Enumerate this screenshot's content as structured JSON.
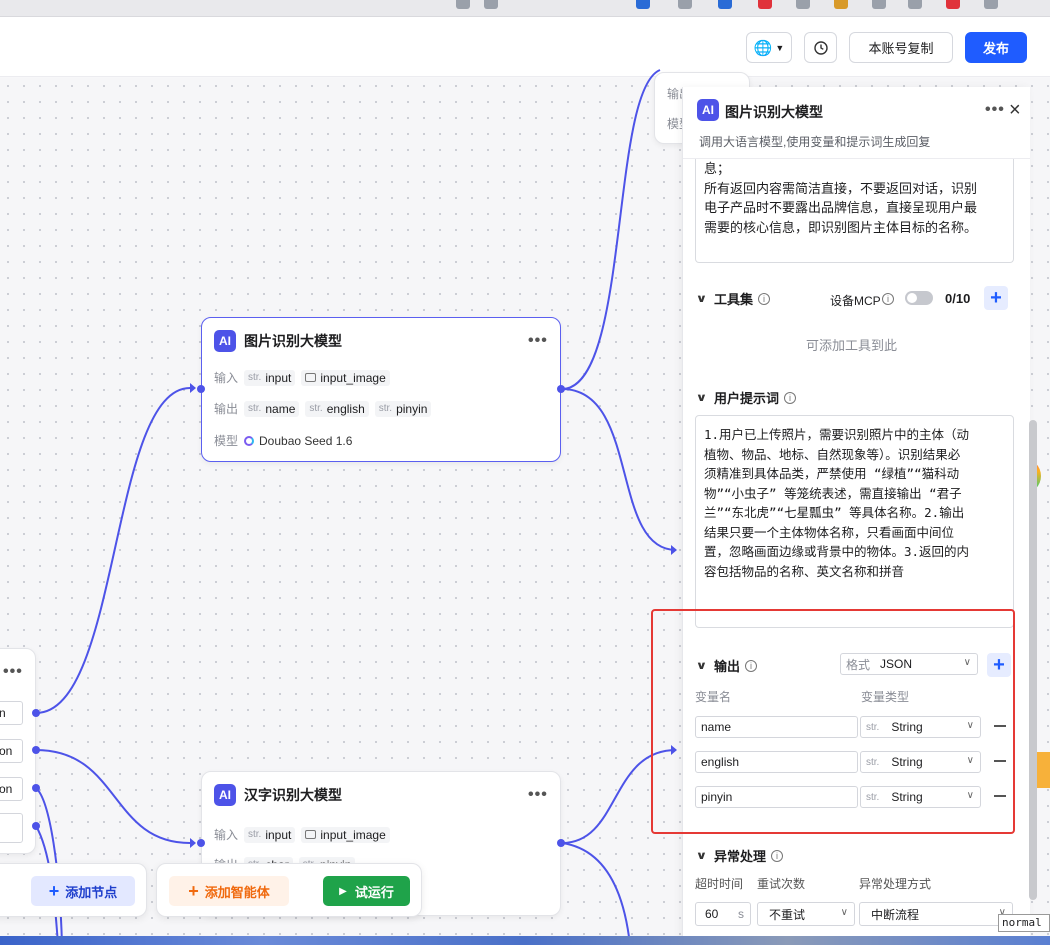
{
  "topbar": {
    "language_icon": "globe-icon",
    "history_icon": "clock-icon",
    "copy_label": "本账号复制",
    "publish_label": "发布"
  },
  "nodes": {
    "image_llm": {
      "title": "图片识别大模型",
      "input_label": "输入",
      "inputs": [
        {
          "type": "str.",
          "name": "input"
        },
        {
          "type": "img",
          "name": "input_image"
        }
      ],
      "output_label": "输出",
      "outputs": [
        {
          "type": "str.",
          "name": "name"
        },
        {
          "type": "str.",
          "name": "english"
        },
        {
          "type": "str.",
          "name": "pinyin"
        }
      ],
      "model_label": "模型",
      "model": "Doubao Seed 1.6"
    },
    "char_llm": {
      "title": "汉字识别大模型",
      "input_label": "输入",
      "inputs": [
        {
          "type": "str.",
          "name": "input"
        },
        {
          "type": "img",
          "name": "input_image"
        }
      ],
      "output_label": "输出",
      "outputs": [
        {
          "type": "str.",
          "name": "char"
        },
        {
          "type": "str.",
          "name": "pinyin"
        }
      ]
    },
    "top_right": {
      "output_label": "输出",
      "model_label": "模型"
    },
    "left_partial": {
      "rows": [
        "n",
        "on",
        "on",
        ""
      ]
    }
  },
  "toolbar": {
    "add_node": "添加节点",
    "add_agent": "添加智能体",
    "test_run": "试运行"
  },
  "panel": {
    "title": "图片识别大模型",
    "subtitle": "调用大语言模型,使用变量和提示词生成回复",
    "system_prompt_lines": [
      "息；",
      "所有返回内容需简洁直接，不要返回对话，识别",
      "电子产品时不要露出品牌信息，直接呈现用户最",
      "需要的核心信息，即识别图片主体目标的名称。"
    ],
    "tools": {
      "title": "工具集",
      "mcp_label": "设备MCP",
      "count": "0/10",
      "empty": "可添加工具到此"
    },
    "user_prompt": {
      "title": "用户提示词",
      "lines": [
        "1.用户已上传照片，需要识别照片中的主体（动",
        "植物、物品、地标、自然现象等）。识别结果必",
        "须精准到具体品类，严禁使用 “绿植”“猫科动",
        "物”“小虫子” 等笼统表述，需直接输出 “君子",
        "兰”“东北虎”“七星瓢虫” 等具体名称。2.输出",
        "结果只要一个主体物体名称，只看画面中间位",
        "置，忽略画面边缘或背景中的物体。3.返回的内",
        "容包括物品的名称、英文名称和拼音"
      ]
    },
    "output": {
      "title": "输出",
      "format_label": "格式",
      "format_value": "JSON",
      "col_name": "变量名",
      "col_type": "变量类型",
      "vars": [
        {
          "name": "name",
          "prefix": "str.",
          "type": "String"
        },
        {
          "name": "english",
          "prefix": "str.",
          "type": "String"
        },
        {
          "name": "pinyin",
          "prefix": "str.",
          "type": "String"
        }
      ]
    },
    "error": {
      "title": "异常处理",
      "col_timeout": "超时时间",
      "col_retry": "重试次数",
      "col_method": "异常处理方式",
      "timeout_value": "60",
      "timeout_unit": "s",
      "retry_value": "不重试",
      "method_value": "中断流程"
    }
  },
  "status_tooltip": "normal"
}
